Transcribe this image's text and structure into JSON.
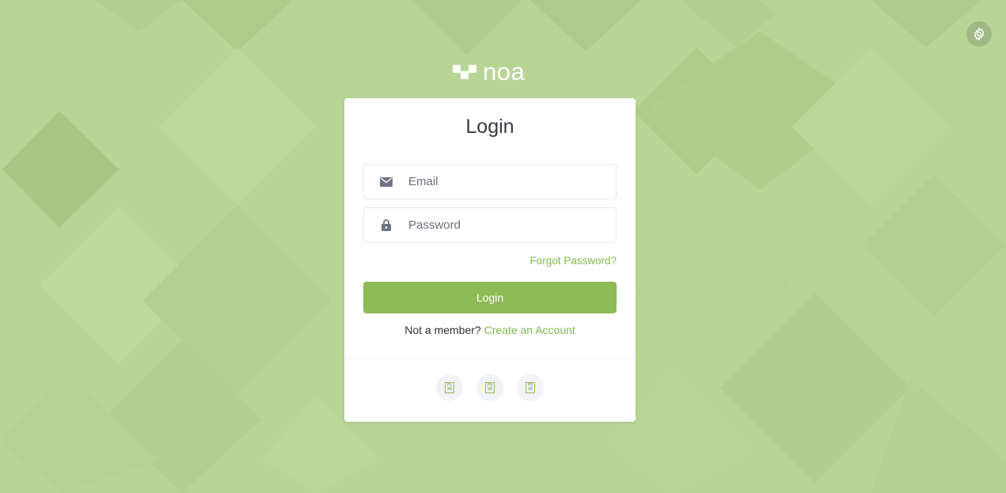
{
  "logo": {
    "text": "noa"
  },
  "login": {
    "title": "Login",
    "email_placeholder": "Email",
    "password_placeholder": "Password",
    "forgot_label": "Forgot Password?",
    "submit_label": "Login",
    "member_text": "Not a member?",
    "create_account_label": "Create an Account"
  },
  "social": [
    {
      "icon": "missing-glyph-icon",
      "glyph_top": "F1",
      "glyph_bottom": "A0"
    },
    {
      "icon": "missing-glyph-icon",
      "glyph_top": "F0",
      "glyph_bottom": "9A"
    },
    {
      "icon": "missing-glyph-icon",
      "glyph_top": "F0",
      "glyph_bottom": "99"
    }
  ],
  "colors": {
    "background": "#b9d595",
    "accent": "#8dbb56",
    "link": "#7fb84d"
  }
}
